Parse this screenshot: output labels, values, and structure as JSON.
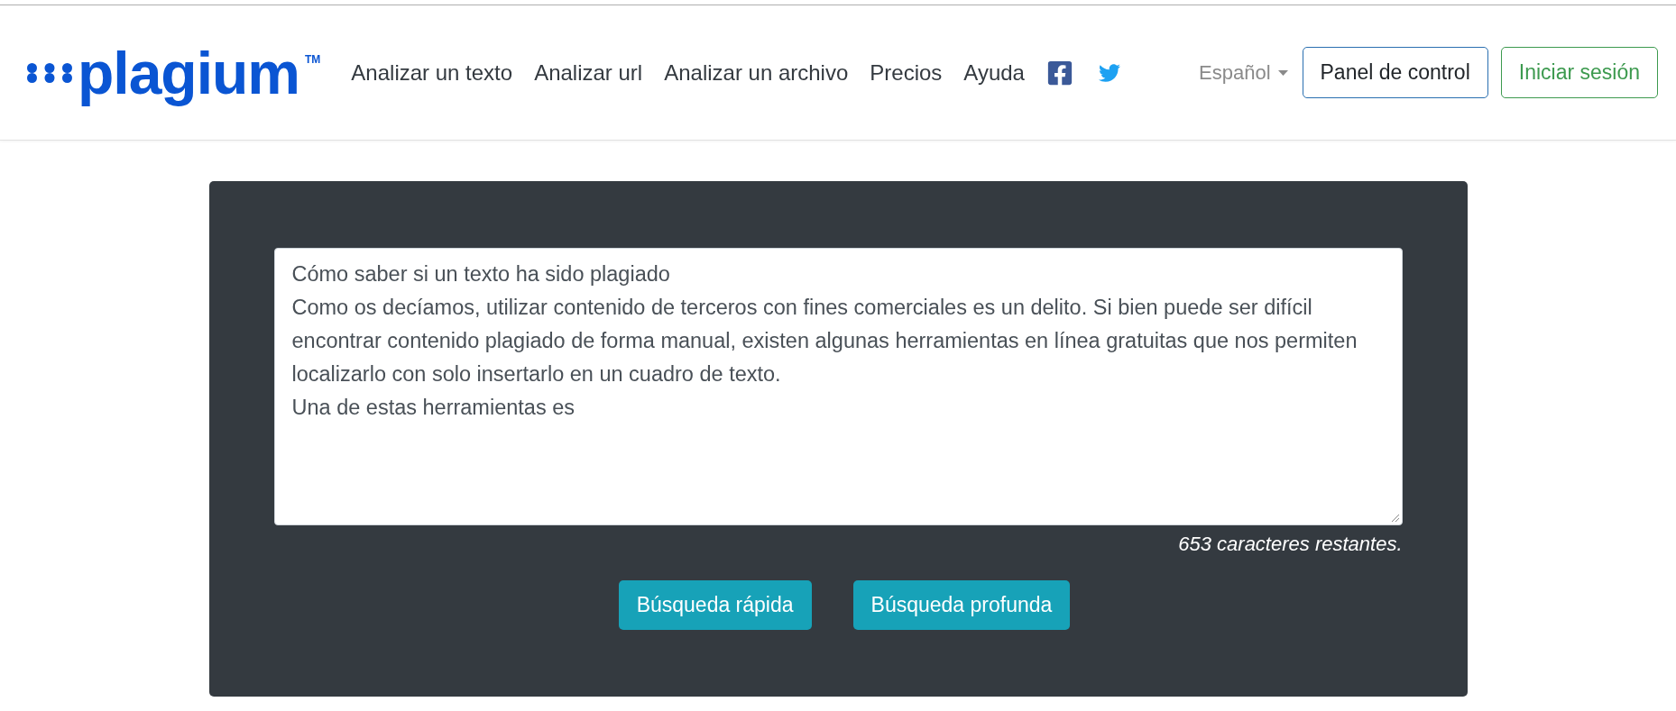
{
  "logo": {
    "name": "plagium",
    "trademark": "TM"
  },
  "nav": {
    "links": [
      "Analizar un texto",
      "Analizar url",
      "Analizar un archivo",
      "Precios",
      "Ayuda"
    ]
  },
  "language": {
    "label": "Español"
  },
  "header_buttons": [
    {
      "label": "Panel de control",
      "kind": "outline-primary"
    },
    {
      "label": "Iniciar sesión",
      "kind": "outline-success"
    }
  ],
  "editor": {
    "value": "Cómo saber si un texto ha sido plagiado\nComo os decíamos, utilizar contenido de terceros con fines comerciales es un delito. Si bien puede ser difícil encontrar contenido plagiado de forma manual, existen algunas herramientas en línea gratuitas que nos permiten localizarlo con solo insertarlo en un cuadro de texto.\nUna de estas herramientas es",
    "counter": "653 caracteres restantes.",
    "buttons": [
      "Búsqueda rápida",
      "Búsqueda profunda"
    ]
  }
}
